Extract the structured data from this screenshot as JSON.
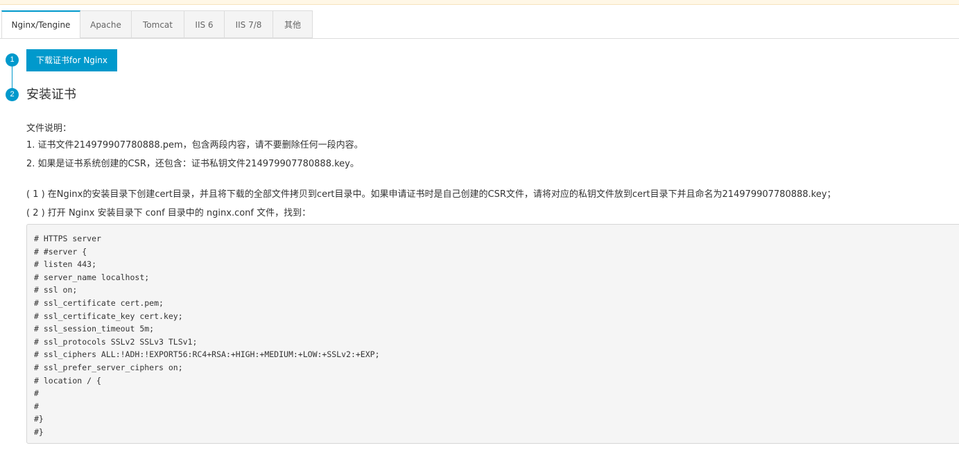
{
  "tabs": [
    {
      "label": "Nginx/Tengine",
      "active": true
    },
    {
      "label": "Apache",
      "active": false
    },
    {
      "label": "Tomcat",
      "active": false
    },
    {
      "label": "IIS 6",
      "active": false
    },
    {
      "label": "IIS 7/8",
      "active": false
    },
    {
      "label": "其他",
      "active": false
    }
  ],
  "steps": {
    "step1_number": "1",
    "step2_number": "2",
    "download_button": "下载证书for Nginx",
    "step2_title": "安装证书"
  },
  "file_notes": {
    "heading": "文件说明：",
    "line1": "1. 证书文件214979907780888.pem，包含两段内容，请不要删除任何一段内容。",
    "line2": "2. 如果是证书系统创建的CSR，还包含：证书私钥文件214979907780888.key。"
  },
  "instructions": {
    "step1": "( 1 ) 在Nginx的安装目录下创建cert目录，并且将下载的全部文件拷贝到cert目录中。如果申请证书时是自己创建的CSR文件，请将对应的私钥文件放到cert目录下并且命名为214979907780888.key；",
    "step2": "( 2 ) 打开 Nginx 安装目录下 conf 目录中的 nginx.conf 文件，找到："
  },
  "code_lines": [
    "# HTTPS server",
    "# #server {",
    "# listen 443;",
    "# server_name localhost;",
    "# ssl on;",
    "# ssl_certificate cert.pem;",
    "# ssl_certificate_key cert.key;",
    "# ssl_session_timeout 5m;",
    "# ssl_protocols SSLv2 SSLv3 TLSv1;",
    "# ssl_ciphers ALL:!ADH:!EXPORT56:RC4+RSA:+HIGH:+MEDIUM:+LOW:+SSLv2:+EXP;",
    "# ssl_prefer_server_ciphers on;",
    "# location / {",
    "#",
    "#",
    "#}",
    "#}"
  ],
  "colors": {
    "accent": "#0099cc",
    "code_bg": "#f5f5f5",
    "notice_bg": "#fff7e6"
  }
}
